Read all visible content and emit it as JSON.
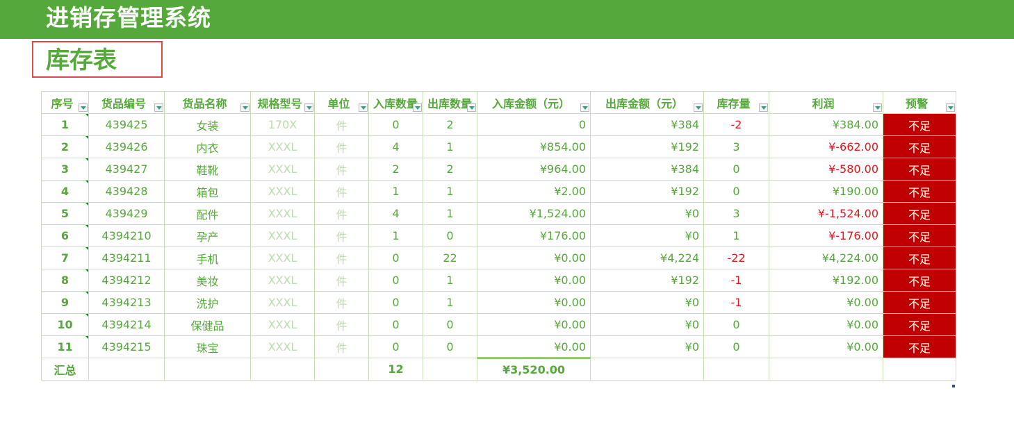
{
  "header": {
    "app_title": "进销存管理系统"
  },
  "sheet": {
    "title": "库存表"
  },
  "table": {
    "columns": [
      "序号",
      "货品编号",
      "货品名称",
      "规格型号",
      "单位",
      "入库数量",
      "出库数量",
      "入库金额（元）",
      "出库金额（元）",
      "库存量",
      "利润",
      "预警"
    ],
    "rows": [
      {
        "seq": "1",
        "code": "439425",
        "name": "女装",
        "spec": "170X",
        "unit": "件",
        "in_qty": "0",
        "out_qty": "2",
        "in_amount": "0",
        "out_amount": "¥384",
        "stock": "-2",
        "profit": "¥384.00",
        "warning": "不足"
      },
      {
        "seq": "2",
        "code": "439426",
        "name": "内衣",
        "spec": "XXXL",
        "unit": "件",
        "in_qty": "4",
        "out_qty": "1",
        "in_amount": "¥854.00",
        "out_amount": "¥192",
        "stock": "3",
        "profit": "¥-662.00",
        "warning": "不足"
      },
      {
        "seq": "3",
        "code": "439427",
        "name": "鞋靴",
        "spec": "XXXL",
        "unit": "件",
        "in_qty": "2",
        "out_qty": "2",
        "in_amount": "¥964.00",
        "out_amount": "¥384",
        "stock": "0",
        "profit": "¥-580.00",
        "warning": "不足"
      },
      {
        "seq": "4",
        "code": "439428",
        "name": "箱包",
        "spec": "XXXL",
        "unit": "件",
        "in_qty": "1",
        "out_qty": "1",
        "in_amount": "¥2.00",
        "out_amount": "¥192",
        "stock": "0",
        "profit": "¥190.00",
        "warning": "不足"
      },
      {
        "seq": "5",
        "code": "439429",
        "name": "配件",
        "spec": "XXXL",
        "unit": "件",
        "in_qty": "4",
        "out_qty": "1",
        "in_amount": "¥1,524.00",
        "out_amount": "¥0",
        "stock": "3",
        "profit": "¥-1,524.00",
        "warning": "不足"
      },
      {
        "seq": "6",
        "code": "4394210",
        "name": "孕产",
        "spec": "XXXL",
        "unit": "件",
        "in_qty": "1",
        "out_qty": "0",
        "in_amount": "¥176.00",
        "out_amount": "¥0",
        "stock": "1",
        "profit": "¥-176.00",
        "warning": "不足"
      },
      {
        "seq": "7",
        "code": "4394211",
        "name": "手机",
        "spec": "XXXL",
        "unit": "件",
        "in_qty": "0",
        "out_qty": "22",
        "in_amount": "¥0.00",
        "out_amount": "¥4,224",
        "stock": "-22",
        "profit": "¥4,224.00",
        "warning": "不足"
      },
      {
        "seq": "8",
        "code": "4394212",
        "name": "美妆",
        "spec": "XXXL",
        "unit": "件",
        "in_qty": "0",
        "out_qty": "1",
        "in_amount": "¥0.00",
        "out_amount": "¥192",
        "stock": "-1",
        "profit": "¥192.00",
        "warning": "不足"
      },
      {
        "seq": "9",
        "code": "4394213",
        "name": "洗护",
        "spec": "XXXL",
        "unit": "件",
        "in_qty": "0",
        "out_qty": "1",
        "in_amount": "¥0.00",
        "out_amount": "¥0",
        "stock": "-1",
        "profit": "¥0.00",
        "warning": "不足"
      },
      {
        "seq": "10",
        "code": "4394214",
        "name": "保健品",
        "spec": "XXXL",
        "unit": "件",
        "in_qty": "0",
        "out_qty": "0",
        "in_amount": "¥0.00",
        "out_amount": "¥0",
        "stock": "0",
        "profit": "¥0.00",
        "warning": "不足"
      },
      {
        "seq": "11",
        "code": "4394215",
        "name": "珠宝",
        "spec": "XXXL",
        "unit": "件",
        "in_qty": "0",
        "out_qty": "0",
        "in_amount": "¥0.00",
        "out_amount": "¥0",
        "stock": "0",
        "profit": "¥0.00",
        "warning": "不足"
      }
    ],
    "total": {
      "label": "汇总",
      "in_qty": "12",
      "in_amount": "¥3,520.00"
    }
  },
  "colors": {
    "brand": "#55a83a",
    "warning_bg": "#c00000",
    "negative": "#e01818",
    "grid_line": "#c6e0b4"
  }
}
